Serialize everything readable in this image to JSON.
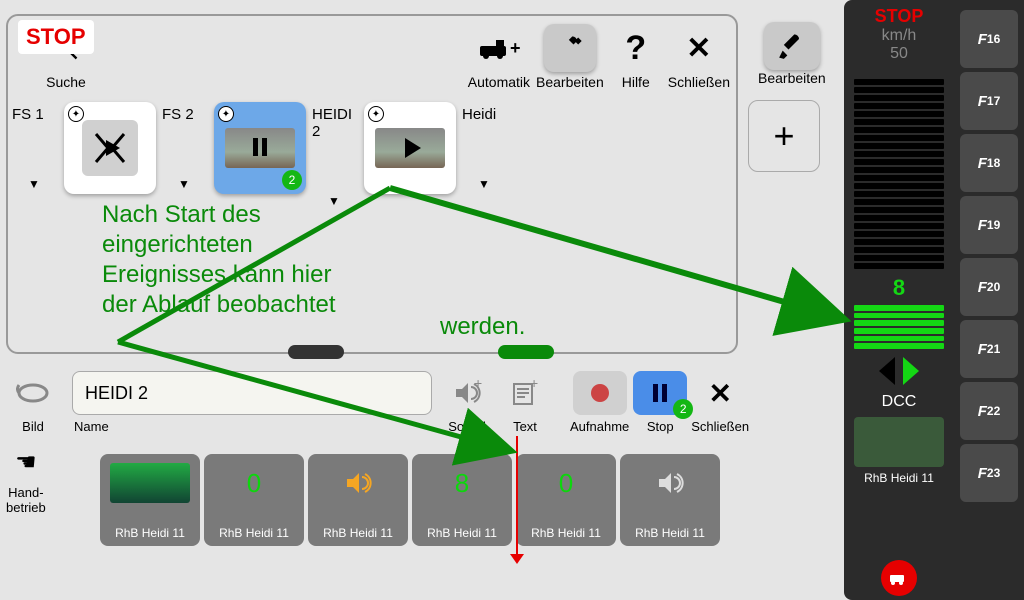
{
  "stop_badge": "STOP",
  "toolbar": {
    "search": "Suche",
    "automatik": "Automatik",
    "bearbeiten": "Bearbeiten",
    "hilfe": "Hilfe",
    "schliessen": "Schließen"
  },
  "outer_edit": "Bearbeiten",
  "events": [
    {
      "label": "FS 1",
      "badge": null
    },
    {
      "label": "FS 2",
      "badge": null
    },
    {
      "label": "HEIDI 2",
      "badge": "2"
    },
    {
      "label": "Heidi",
      "badge": null
    }
  ],
  "annotation_lines": "Nach Start des\neingerichteten\nEreignisses kann hier\nder Ablauf beobachtet",
  "annotation_tail": "werden.",
  "bottom": {
    "bild": "Bild",
    "name_label": "Name",
    "name_value": "HEIDI 2",
    "sound": "Sound",
    "text": "Text",
    "aufnahme": "Aufnahme",
    "stop": "Stop",
    "stop_badge": "2",
    "schliessen": "Schließen",
    "handbetrieb": "Hand-\nbetrieb"
  },
  "sequence": [
    {
      "val_type": "loco",
      "label": "RhB Heidi 11"
    },
    {
      "val_type": "num",
      "val": "0",
      "label": "RhB Heidi 11"
    },
    {
      "val_type": "speaker_on",
      "label": "RhB Heidi 11"
    },
    {
      "val_type": "num",
      "val": "8",
      "label": "RhB Heidi 11"
    },
    {
      "val_type": "num",
      "val": "0",
      "label": "RhB Heidi 11"
    },
    {
      "val_type": "speaker",
      "label": "RhB Heidi 11"
    }
  ],
  "speedo": {
    "stop": "STOP",
    "unit": "km/h",
    "max": "50",
    "value": "8",
    "protocol": "DCC",
    "loco_label": "RhB Heidi 11",
    "bars_total": 24,
    "bars_on": 6
  },
  "fkeys": [
    "16",
    "17",
    "18",
    "19",
    "20",
    "21",
    "22",
    "23"
  ]
}
